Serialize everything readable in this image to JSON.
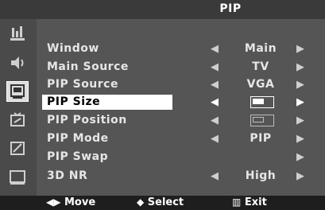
{
  "header": {
    "title": "PIP"
  },
  "sidebar": {
    "icons": [
      "picture-icon",
      "sound-icon",
      "channel-icon",
      "setup-icon",
      "input-icon",
      "application-icon"
    ],
    "active": "channel-icon"
  },
  "menu": {
    "items": [
      {
        "label": "Window",
        "value": "Main"
      },
      {
        "label": "Main Source",
        "value": "TV"
      },
      {
        "label": "PIP Source",
        "value": "VGA"
      },
      {
        "label": "PIP Size",
        "value_icon": "pip-size-large-icon",
        "selected": true
      },
      {
        "label": "PIP Position",
        "value_icon": "pip-position-icon"
      },
      {
        "label": "PIP Mode",
        "value": "PIP"
      },
      {
        "label": "PIP Swap",
        "value": ""
      },
      {
        "label": "3D NR",
        "value": "High"
      }
    ]
  },
  "footer": {
    "move_label": "Move",
    "select_label": "Select",
    "exit_label": "Exit"
  },
  "colors": {
    "background": "#555555",
    "title_bar": "#3a3a3a",
    "footer": "#1e1e1e",
    "highlight": "#ffffff"
  }
}
